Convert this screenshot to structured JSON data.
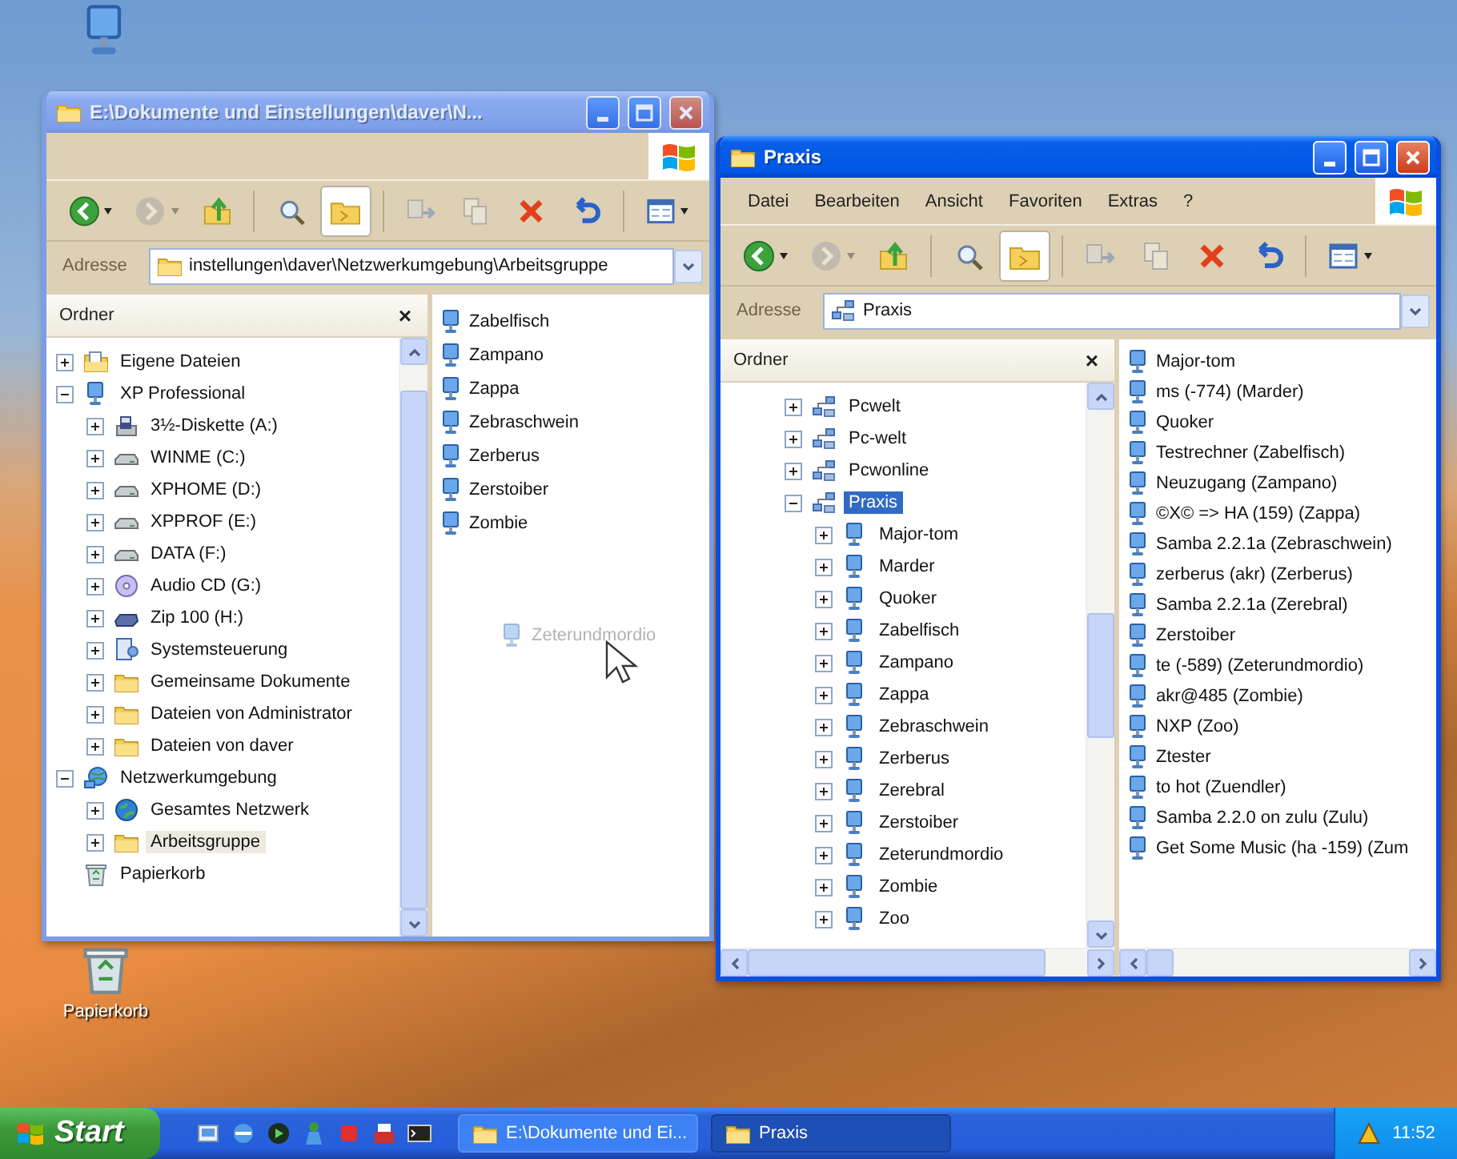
{
  "desktop": {
    "icons": [
      {
        "kind": "computer"
      },
      {
        "kind": "recycle",
        "label": "Papierkorb"
      }
    ]
  },
  "windows": [
    {
      "title": "E:\\Dokumente und Einstellungen\\daver\\N...",
      "active": false,
      "toolbar": [
        {
          "kind": "back",
          "disabled": false,
          "pressed": false
        },
        {
          "kind": "forward",
          "disabled": true,
          "pressed": false
        },
        {
          "kind": "up",
          "disabled": false,
          "pressed": false
        },
        {
          "kind": "search",
          "disabled": false,
          "pressed": false
        },
        {
          "kind": "folders",
          "disabled": false,
          "pressed": true
        },
        {
          "kind": "move",
          "disabled": true,
          "pressed": false
        },
        {
          "kind": "copy",
          "disabled": true,
          "pressed": false
        },
        {
          "kind": "delete",
          "disabled": false,
          "pressed": false
        },
        {
          "kind": "undo",
          "disabled": false,
          "pressed": false
        },
        {
          "kind": "views",
          "disabled": false,
          "pressed": false
        }
      ],
      "address": {
        "label": "Adresse",
        "kind": "folder",
        "value": "instellungen\\daver\\Netzwerkumgebung\\Arbeitsgruppe"
      },
      "folders_pane": {
        "title": "Ordner",
        "close": "×",
        "tree": [
          {
            "label": "Eigene Dateien",
            "kind": "documents",
            "expanded": false,
            "selected": false
          },
          {
            "label": "XP Professional",
            "kind": "computer",
            "expanded": true,
            "selected": false,
            "children": [
              {
                "label": "3½-Diskette (A:)",
                "kind": "floppy",
                "expanded": false,
                "selected": false
              },
              {
                "label": "WINME (C:)",
                "kind": "drive",
                "expanded": false,
                "selected": false
              },
              {
                "label": "XPHOME (D:)",
                "kind": "drive",
                "expanded": false,
                "selected": false
              },
              {
                "label": "XPPROF (E:)",
                "kind": "drive",
                "expanded": false,
                "selected": false
              },
              {
                "label": "DATA (F:)",
                "kind": "drive",
                "expanded": false,
                "selected": false
              },
              {
                "label": "Audio CD (G:)",
                "kind": "cd",
                "expanded": false,
                "selected": false
              },
              {
                "label": "Zip 100 (H:)",
                "kind": "zip",
                "expanded": false,
                "selected": false
              },
              {
                "label": "Systemsteuerung",
                "kind": "control",
                "expanded": false,
                "selected": false
              },
              {
                "label": "Gemeinsame Dokumente",
                "kind": "folder",
                "expanded": false,
                "selected": false
              },
              {
                "label": "Dateien von Administrator",
                "kind": "folder",
                "expanded": false,
                "selected": false
              },
              {
                "label": "Dateien von daver",
                "kind": "folder",
                "expanded": false,
                "selected": false
              }
            ]
          },
          {
            "label": "Netzwerkumgebung",
            "kind": "network",
            "expanded": true,
            "selected": false,
            "children": [
              {
                "label": "Gesamtes Netzwerk",
                "kind": "globe",
                "expanded": false,
                "selected": false
              },
              {
                "label": "Arbeitsgruppe",
                "kind": "folder",
                "expanded": false,
                "selected": true
              }
            ]
          },
          {
            "label": "Papierkorb",
            "kind": "recycle",
            "selected": false
          }
        ]
      },
      "items": [
        {
          "label": "Zabelfisch"
        },
        {
          "label": "Zampano"
        },
        {
          "label": "Zappa"
        },
        {
          "label": "Zebraschwein"
        },
        {
          "label": "Zerberus"
        },
        {
          "label": "Zerstoiber"
        },
        {
          "label": "Zombie"
        }
      ],
      "drag_ghost": {
        "label": "Zeterundmordio"
      }
    },
    {
      "title": "Praxis",
      "active": true,
      "menu": [
        "Datei",
        "Bearbeiten",
        "Ansicht",
        "Favoriten",
        "Extras",
        "?"
      ],
      "toolbar": [
        {
          "kind": "back",
          "disabled": false,
          "pressed": false
        },
        {
          "kind": "forward",
          "disabled": true,
          "pressed": false
        },
        {
          "kind": "up",
          "disabled": false,
          "pressed": false
        },
        {
          "kind": "search",
          "disabled": false,
          "pressed": false
        },
        {
          "kind": "folders",
          "disabled": false,
          "pressed": true
        },
        {
          "kind": "move",
          "disabled": true,
          "pressed": false
        },
        {
          "kind": "copy",
          "disabled": true,
          "pressed": false
        },
        {
          "kind": "delete",
          "disabled": false,
          "pressed": false
        },
        {
          "kind": "undo",
          "disabled": false,
          "pressed": false
        },
        {
          "kind": "views",
          "disabled": false,
          "pressed": false
        }
      ],
      "address": {
        "label": "Adresse",
        "kind": "workgroup",
        "value": "Praxis"
      },
      "folders_pane": {
        "title": "Ordner",
        "close": "×",
        "tree": [
          {
            "label": "Pcwelt",
            "kind": "workgroup",
            "expanded": false,
            "selected": false
          },
          {
            "label": "Pc-welt",
            "kind": "workgroup",
            "expanded": false,
            "selected": false
          },
          {
            "label": "Pcwonline",
            "kind": "workgroup",
            "expanded": false,
            "selected": false
          },
          {
            "label": "Praxis",
            "kind": "workgroup",
            "expanded": true,
            "selected": true,
            "children": [
              {
                "label": "Major-tom",
                "kind": "computer",
                "expanded": false,
                "selected": false
              },
              {
                "label": "Marder",
                "kind": "computer",
                "expanded": false,
                "selected": false
              },
              {
                "label": "Quoker",
                "kind": "computer",
                "expanded": false,
                "selected": false
              },
              {
                "label": "Zabelfisch",
                "kind": "computer",
                "expanded": false,
                "selected": false
              },
              {
                "label": "Zampano",
                "kind": "computer",
                "expanded": false,
                "selected": false
              },
              {
                "label": "Zappa",
                "kind": "computer",
                "expanded": false,
                "selected": false
              },
              {
                "label": "Zebraschwein",
                "kind": "computer",
                "expanded": false,
                "selected": false
              },
              {
                "label": "Zerberus",
                "kind": "computer",
                "expanded": false,
                "selected": false
              },
              {
                "label": "Zerebral",
                "kind": "computer",
                "expanded": false,
                "selected": false
              },
              {
                "label": "Zerstoiber",
                "kind": "computer",
                "expanded": false,
                "selected": false
              },
              {
                "label": "Zeterundmordio",
                "kind": "computer",
                "expanded": false,
                "selected": false
              },
              {
                "label": "Zombie",
                "kind": "computer",
                "expanded": false,
                "selected": false
              },
              {
                "label": "Zoo",
                "kind": "computer",
                "expanded": false,
                "selected": false
              }
            ]
          }
        ]
      },
      "items": [
        {
          "label": "Major-tom"
        },
        {
          "label": "ms (-774) (Marder)"
        },
        {
          "label": "Quoker"
        },
        {
          "label": "Testrechner (Zabelfisch)"
        },
        {
          "label": "Neuzugang (Zampano)"
        },
        {
          "label": "©X© => HA (159) (Zappa)"
        },
        {
          "label": "Samba 2.2.1a (Zebraschwein)"
        },
        {
          "label": "zerberus (akr) (Zerberus)"
        },
        {
          "label": "Samba 2.2.1a (Zerebral)"
        },
        {
          "label": "Zerstoiber"
        },
        {
          "label": "te (-589) (Zeterundmordio)"
        },
        {
          "label": "akr@485 (Zombie)"
        },
        {
          "label": "NXP (Zoo)"
        },
        {
          "label": "Ztester"
        },
        {
          "label": "to hot (Zuendler)"
        },
        {
          "label": "Samba 2.2.0 on zulu (Zulu)"
        },
        {
          "label": "Get Some Music (ha -159) (Zum"
        }
      ]
    }
  ],
  "taskbar": {
    "start": "Start",
    "tasks": [
      {
        "label": "E:\\Dokumente und Ei...",
        "selected": false
      },
      {
        "label": "Praxis",
        "selected": true
      }
    ],
    "clock": "11:52"
  }
}
